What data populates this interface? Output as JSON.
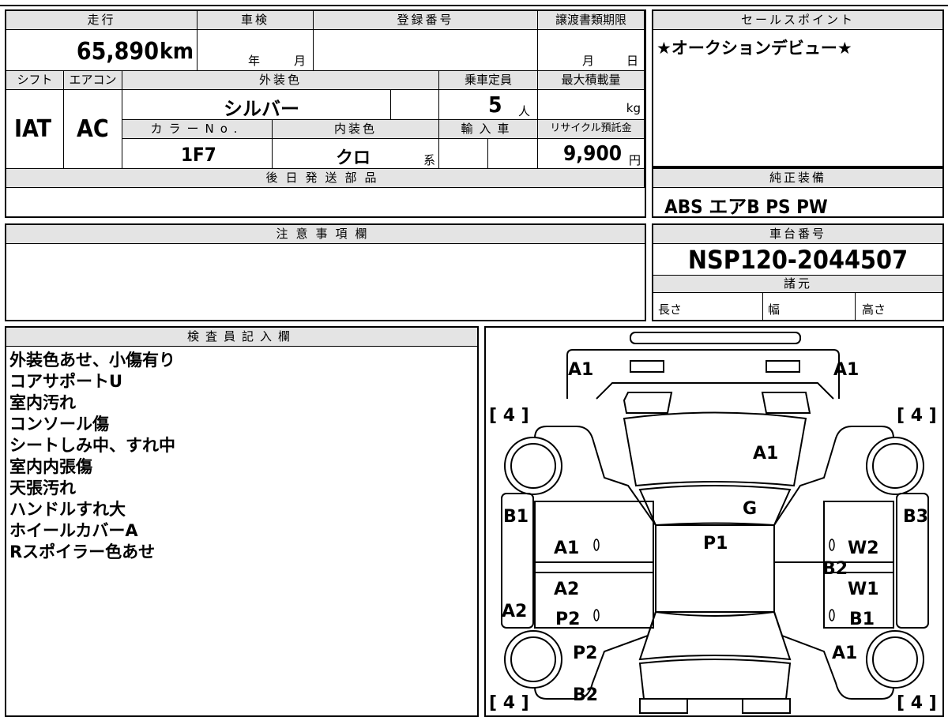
{
  "vehicle": {
    "mileage_label": "走行",
    "mileage": "65,890",
    "mileage_unit": "km",
    "shaken_label": "車検",
    "shaken_year_unit": "年",
    "shaken_month_unit": "月",
    "reg_label": "登録番号",
    "transfer_label": "譲渡書類期限",
    "transfer_month_unit": "月",
    "transfer_day_unit": "日",
    "shift_label": "シフト",
    "shift": "IAT",
    "ac_label": "エアコン",
    "ac": "AC",
    "ext_color_label": "外装色",
    "ext_color": "シルバー",
    "capacity_label": "乗車定員",
    "capacity": "5",
    "capacity_unit": "人",
    "maxload_label": "最大積載量",
    "maxload_unit": "kg",
    "color_no_label": "カラーNo.",
    "color_no": "1F7",
    "int_color_label": "内装色",
    "int_color": "クロ",
    "int_color_suffix": "系",
    "import_label": "輸入車",
    "recycle_label": "リサイクル預託金",
    "recycle": "9,900",
    "recycle_unit": "円",
    "later_parts_label": "後日発送部品"
  },
  "sales_point": {
    "label": "セールスポイント",
    "text": "★オークションデビュー★"
  },
  "equipment": {
    "label": "純正装備",
    "text": "ABS エアB PS PW"
  },
  "caution": {
    "label": "注意事項欄"
  },
  "chassis": {
    "label": "車台番号",
    "number": "NSP120-2044507",
    "specs_label": "諸元",
    "length_label": "長さ",
    "width_label": "幅",
    "height_label": "高さ"
  },
  "inspector": {
    "label": "検査員記入欄",
    "notes": [
      "外装色あせ、小傷有り",
      "コアサポートU",
      "室内汚れ",
      "コンソール傷",
      "シートしみ中、すれ中",
      "室内内張傷",
      "天張汚れ",
      "ハンドルすれ大",
      "ホイールカバーA",
      "Rスポイラー色あせ"
    ]
  },
  "diagram": {
    "marks": {
      "front_left_a1": "A1",
      "front_right_a1": "A1",
      "hood_a1": "A1",
      "windshield_g": "G",
      "roof_p1": "P1",
      "left_b1": "B1",
      "left_front_door_a1": "A1",
      "left_rear_door_a2": "A2",
      "left_rear_door_p2": "P2",
      "left_a2": "A2",
      "left_rear_p2": "P2",
      "rear_b2": "B2",
      "right_b3": "B3",
      "right_front_door_w2": "W2",
      "right_b2": "B2",
      "right_rear_door_w1": "W1",
      "right_rear_door_b1": "B1",
      "right_rear_a1": "A1"
    },
    "tire_fl": "[ 4 ]",
    "tire_fr": "[ 4 ]",
    "tire_rl": "[ 4 ]",
    "tire_rr": "[ 4 ]"
  }
}
